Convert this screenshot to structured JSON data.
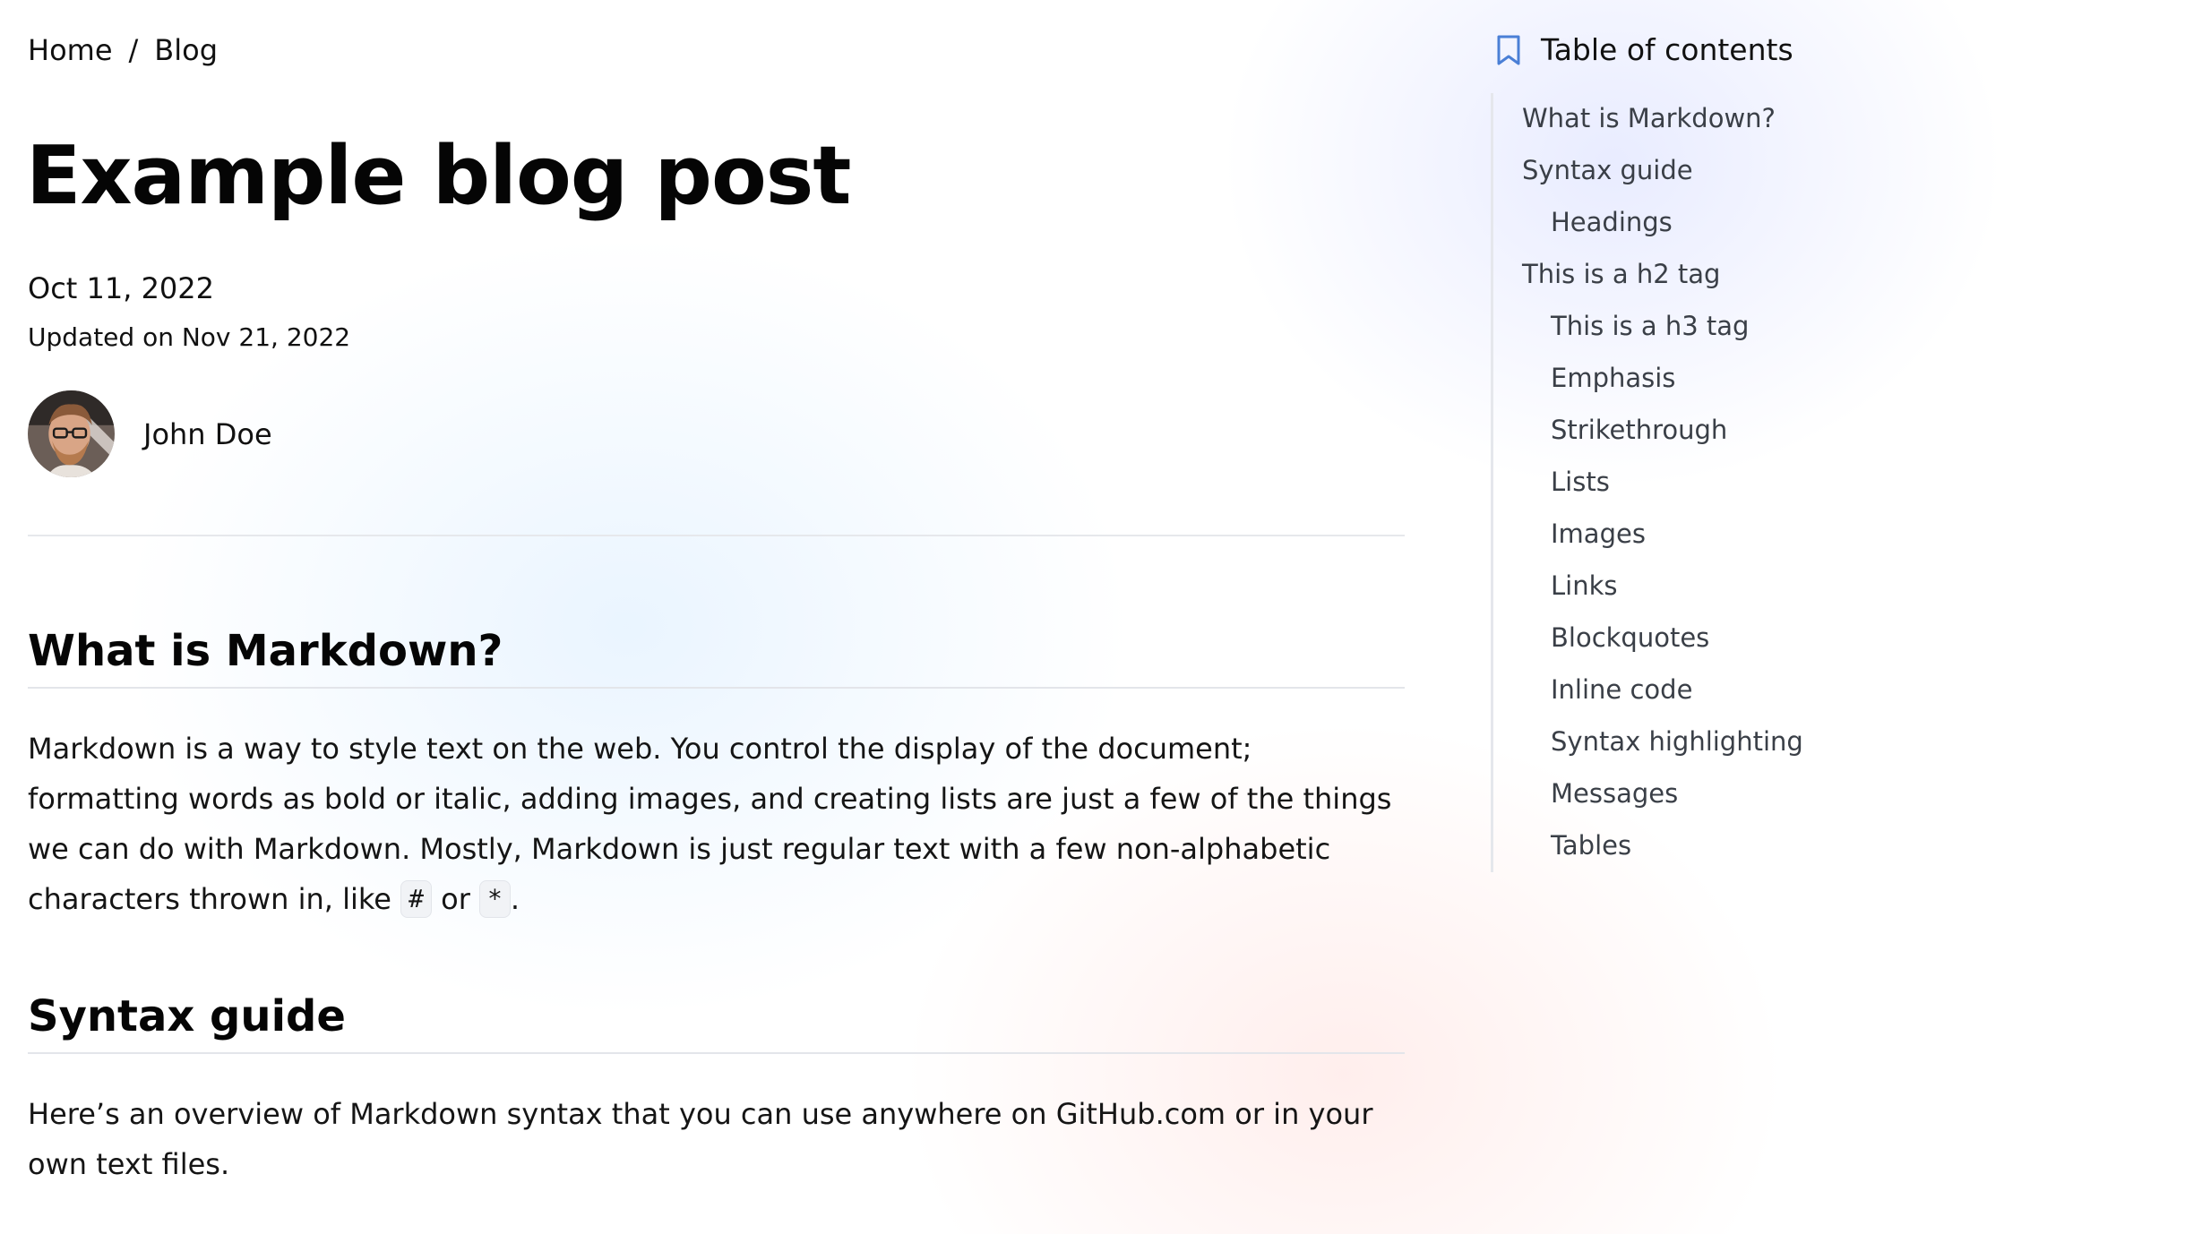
{
  "breadcrumb": {
    "home": "Home",
    "separator": "/",
    "current": "Blog"
  },
  "post": {
    "title": "Example blog post",
    "date": "Oct 11, 2022",
    "updated": "Updated on Nov 21, 2022",
    "author": {
      "name": "John Doe"
    }
  },
  "sections": {
    "markdown": {
      "heading": "What is Markdown?",
      "text_main": "Markdown is a way to style text on the web. You control the display of the document; formatting words as bold or italic, adding images, and creating lists are just a few of the things we can do with Markdown. Mostly, Markdown is just regular text with a few non-alphabetic characters thrown in, like ",
      "code_hash": "#",
      "text_or": " or ",
      "code_star": "*",
      "text_end": "."
    },
    "syntax": {
      "heading": "Syntax guide",
      "text": "Here’s an overview of Markdown syntax that you can use anywhere on GitHub.com or in your own text files."
    }
  },
  "toc": {
    "title": "Table of contents",
    "icon": "bookmark-icon",
    "accent_color": "#4a7fd6",
    "items": [
      {
        "label": "What is Markdown?",
        "level": 2
      },
      {
        "label": "Syntax guide",
        "level": 2
      },
      {
        "label": "Headings",
        "level": 3
      },
      {
        "label": "This is a h2 tag",
        "level": 2
      },
      {
        "label": "This is a h3 tag",
        "level": 3
      },
      {
        "label": "Emphasis",
        "level": 3
      },
      {
        "label": "Strikethrough",
        "level": 3
      },
      {
        "label": "Lists",
        "level": 3
      },
      {
        "label": "Images",
        "level": 3
      },
      {
        "label": "Links",
        "level": 3
      },
      {
        "label": "Blockquotes",
        "level": 3
      },
      {
        "label": "Inline code",
        "level": 3
      },
      {
        "label": "Syntax highlighting",
        "level": 3
      },
      {
        "label": "Messages",
        "level": 3
      },
      {
        "label": "Tables",
        "level": 3
      }
    ]
  }
}
